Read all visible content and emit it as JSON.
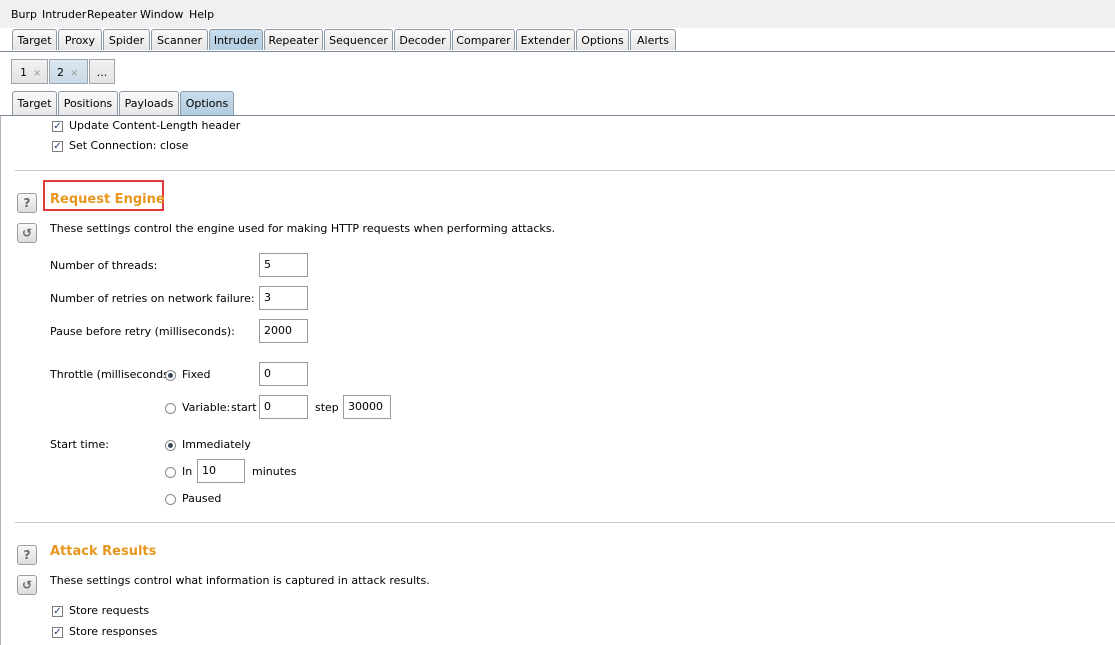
{
  "menu": [
    "Burp",
    "Intruder",
    "Repeater",
    "Window",
    "Help"
  ],
  "main_tabs": [
    "Target",
    "Proxy",
    "Spider",
    "Scanner",
    "Intruder",
    "Repeater",
    "Sequencer",
    "Decoder",
    "Comparer",
    "Extender",
    "Options",
    "Alerts"
  ],
  "selected_main_tab": "Intruder",
  "attack_tabs": [
    {
      "label": "1",
      "close": "×"
    },
    {
      "label": "2",
      "close": "×"
    },
    {
      "label": "..."
    }
  ],
  "sub_tabs": [
    "Target",
    "Positions",
    "Payloads",
    "Options"
  ],
  "selected_sub_tab": "Options",
  "request_headers": {
    "update_content_length": "Update Content-Length header",
    "set_connection_close": "Set Connection: close"
  },
  "request_engine": {
    "title": "Request Engine",
    "description": "These settings control the engine used for making HTTP requests when performing attacks.",
    "threads_label": "Number of threads:",
    "threads_value": "5",
    "retries_label": "Number of retries on network failure:",
    "retries_value": "3",
    "pause_label": "Pause before retry (milliseconds):",
    "pause_value": "2000",
    "throttle_label": "Throttle (milliseconds):",
    "fixed_label": "Fixed",
    "fixed_value": "0",
    "variable_label": "Variable:",
    "start_label": "start",
    "variable_start_value": "0",
    "step_label": "step",
    "variable_step_value": "30000",
    "start_time_label": "Start time:",
    "immediately_label": "Immediately",
    "in_label": "In",
    "in_value": "10",
    "minutes_label": "minutes",
    "paused_label": "Paused"
  },
  "attack_results": {
    "title": "Attack Results",
    "description": "These settings control what information is captured in attack results.",
    "store_requests": "Store requests",
    "store_responses": "Store responses"
  },
  "icons": {
    "help": "?",
    "reset": "↺",
    "check": "✓"
  },
  "colors": {
    "section_title": "#e8961c",
    "highlight": "#e03a3a",
    "selected_tab": "#b3cde0"
  }
}
